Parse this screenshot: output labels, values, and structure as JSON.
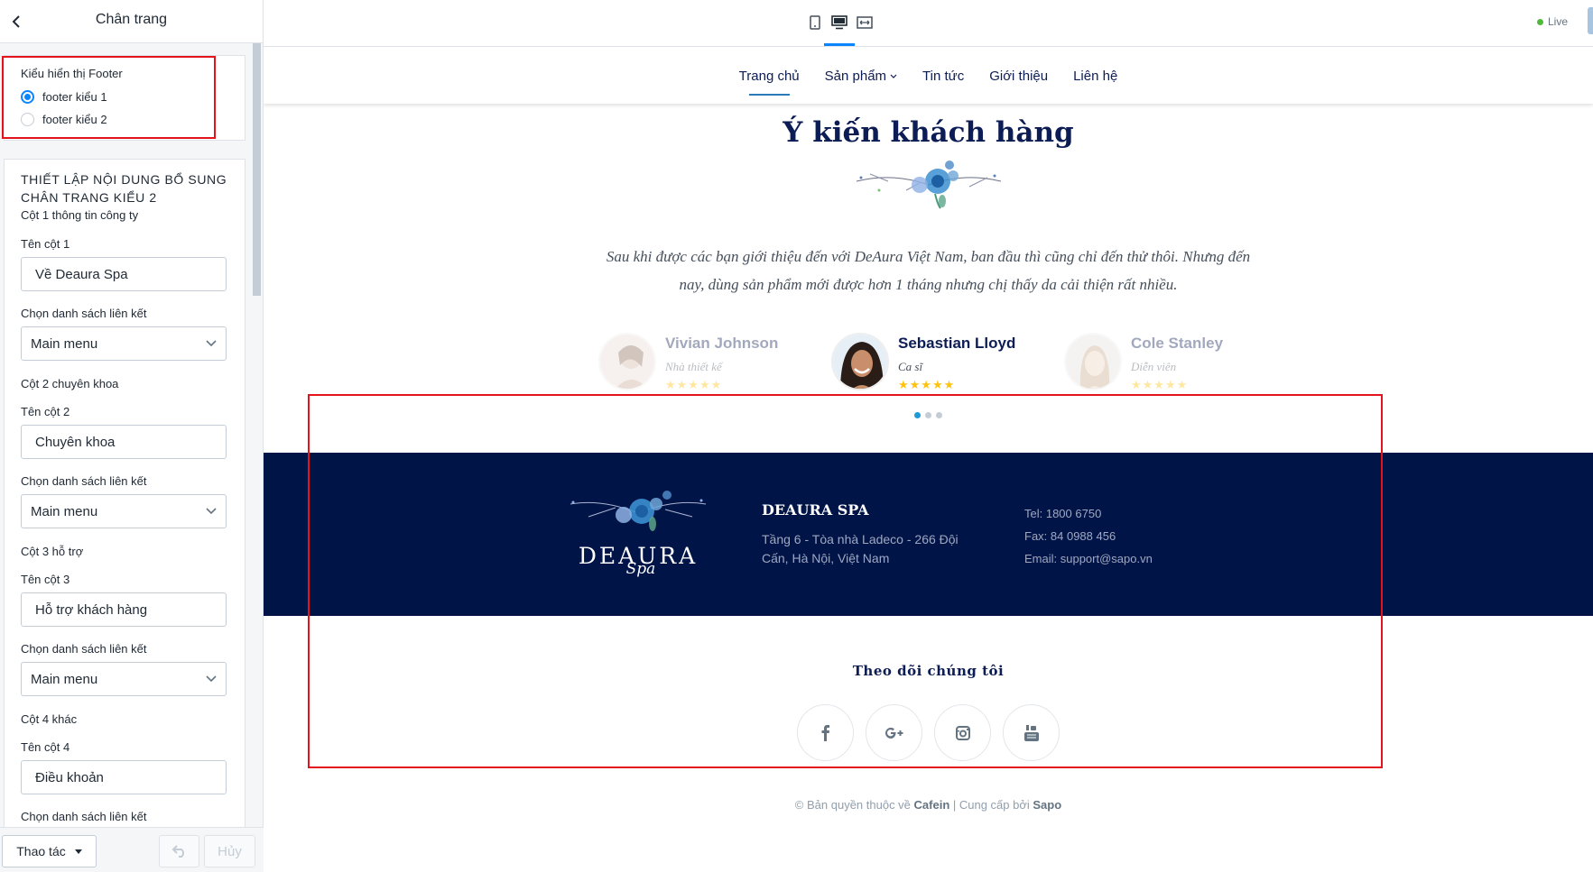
{
  "editor": {
    "title": "Chân trang",
    "display": {
      "label": "Kiểu hiển thị Footer",
      "options": [
        "footer kiểu 1",
        "footer kiểu 2"
      ],
      "selected": "footer kiểu 1"
    },
    "settings": {
      "title": "THIẾT LẬP NỘI DUNG BỔ SUNG CHÂN TRANG KIỂU 2",
      "subtitle": "Cột 1 thông tin công ty",
      "col1_label": "Tên cột 1",
      "col1_value": "Về Deaura Spa",
      "link_label": "Chọn danh sách liên kết",
      "link_value": "Main menu",
      "group2": "Cột 2 chuyên khoa",
      "col2_label": "Tên cột 2",
      "col2_value": "Chuyên khoa",
      "group3": "Cột 3 hỗ trợ",
      "col3_label": "Tên cột 3",
      "col3_value": "Hỗ trợ khách hàng",
      "group4": "Cột 4 khác",
      "col4_label": "Tên cột 4",
      "col4_value": "Điều khoản"
    },
    "footer": {
      "action": "Thao tác",
      "cancel": "Hủy"
    }
  },
  "preview": {
    "live": "Live",
    "nav": [
      "Trang chủ",
      "Sản phẩm",
      "Tin tức",
      "Giới thiệu",
      "Liên hệ"
    ],
    "testimonial": {
      "title": "Ý kiến khách hàng",
      "quote": "Sau khi được các bạn giới thiệu đến với DeAura Việt Nam, ban đầu thì cũng chỉ đến thử thôi. Nhưng đến nay, dùng sản phẩm mới được hơn 1 tháng nhưng chị thấy da cải thiện rất nhiều.",
      "people": [
        {
          "name": "Vivian Johnson",
          "role": "Nhà thiết kế"
        },
        {
          "name": "Sebastian Lloyd",
          "role": "Ca sĩ"
        },
        {
          "name": "Cole Stanley",
          "role": "Diễn viên"
        }
      ],
      "stars": "★★★★★"
    },
    "footer": {
      "logo_word": "DEAURA",
      "logo_spa": "Spa",
      "brand": "DEAURA SPA",
      "address": "Tầng 6 - Tòa nhà Ladeco - 266 Đội Cấn, Hà Nội, Việt Nam",
      "tel": "Tel: 1800 6750",
      "fax": "Fax: 84 0988 456",
      "email": "Email: support@sapo.vn",
      "follow_title": "Theo dõi chúng tôi",
      "copyright_pre": "© Bản quyền thuộc về ",
      "copyright_brand": "Cafein",
      "copyright_mid": " | Cung cấp bởi ",
      "copyright_provider": "Sapo"
    }
  },
  "colors": {
    "navy": "#001448",
    "accent": "#0a84ff",
    "highlight_red": "#e4141c",
    "star": "#ffc20e"
  }
}
